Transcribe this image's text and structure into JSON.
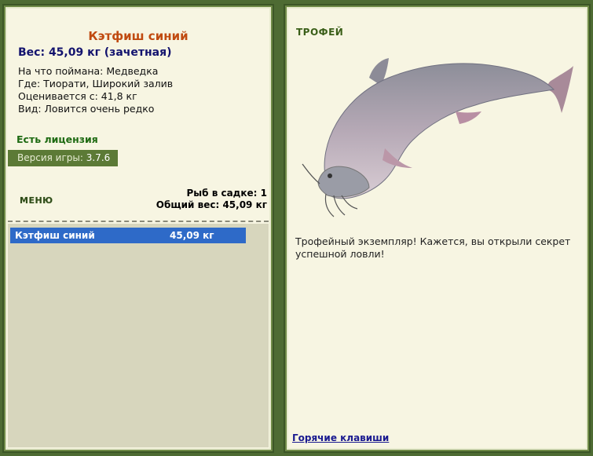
{
  "fish": {
    "name": "Кэтфиш синий",
    "weight": "Вес: 45,09 кг (зачетная)",
    "bait": "На что поймана: Медведка",
    "location": "Где: Тиорати, Широкий залив",
    "value": "Оценивается с: 41,8 кг",
    "rarity": "Вид: Ловится очень редко"
  },
  "license": "Есть лицензия",
  "version": {
    "label": "Версия игры:",
    "number": "3.7.6"
  },
  "menu": "МЕНЮ",
  "stats": {
    "fish_count": "Рыб в садке: 1",
    "total_weight": "Общий вес: 45,09 кг"
  },
  "cage": [
    {
      "name": "Кэтфиш синий",
      "weight": "45,09 кг"
    }
  ],
  "trophy": {
    "label": "ТРОФЕЙ",
    "text": "Трофейный экземпляр! Кажется, вы открыли секрет успешной ловли!"
  },
  "hotkeys": "Горячие клавиши",
  "colors": {
    "background": "#4e6b33",
    "panel": "#f7f5e2",
    "fish_title": "#c04a10",
    "selected_row": "#2e6ac8"
  }
}
